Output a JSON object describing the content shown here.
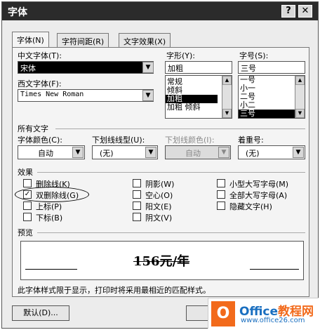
{
  "window": {
    "title": "字体",
    "help_glyph": "?",
    "close_glyph": "✕"
  },
  "tabs": [
    {
      "label": "字体(N)",
      "active": true
    },
    {
      "label": "字符间距(R)",
      "active": false
    },
    {
      "label": "文字效果(X)",
      "active": false
    }
  ],
  "font": {
    "cn_label": "中文字体(T):",
    "cn_value": "宋体",
    "west_label": "西文字体(F):",
    "west_value": "Times New Roman",
    "style_label": "字形(Y):",
    "style_value": "加粗",
    "style_options": [
      "常规",
      "倾斜",
      "加粗",
      "加粗 倾斜"
    ],
    "style_selected_index": 2,
    "size_label": "字号(S):",
    "size_value": "三号",
    "size_options": [
      "一号",
      "小一",
      "二号",
      "小二",
      "三号"
    ],
    "size_selected_index": 4
  },
  "all_text": {
    "heading": "所有文字",
    "color_label": "字体颜色(C):",
    "color_value": "自动",
    "underline_label": "下划线线型(U):",
    "underline_value": "(无)",
    "underline_color_label": "下划线颜色(I):",
    "underline_color_value": "自动",
    "emphasis_label": "着重号:",
    "emphasis_value": "(无)"
  },
  "effects": {
    "heading": "效果",
    "items": [
      {
        "label": "删除线(K)",
        "checked": false
      },
      {
        "label": "双删除线(G)",
        "checked": true
      },
      {
        "label": "上标(P)",
        "checked": false
      },
      {
        "label": "下标(B)",
        "checked": false
      },
      {
        "label": "阴影(W)",
        "checked": false
      },
      {
        "label": "空心(O)",
        "checked": false
      },
      {
        "label": "阳文(E)",
        "checked": false
      },
      {
        "label": "阴文(V)",
        "checked": false
      },
      {
        "label": "小型大写字母(M)",
        "checked": false
      },
      {
        "label": "全部大写字母(A)",
        "checked": false
      },
      {
        "label": "隐藏文字(H)",
        "checked": false
      }
    ]
  },
  "preview": {
    "heading": "预览",
    "sample": "156元/年"
  },
  "note": "此字体样式限于显示，打印时将采用最相近的匹配样式。",
  "buttons": {
    "default": "默认(D)..."
  },
  "watermark": {
    "logo": "O",
    "brand": "Office",
    "brand_cn": "教程网",
    "url": "www.office26.com"
  },
  "icons": {
    "dropdown": "▼",
    "scroll_up": "▲",
    "scroll_down": "▼",
    "check": "✓"
  }
}
